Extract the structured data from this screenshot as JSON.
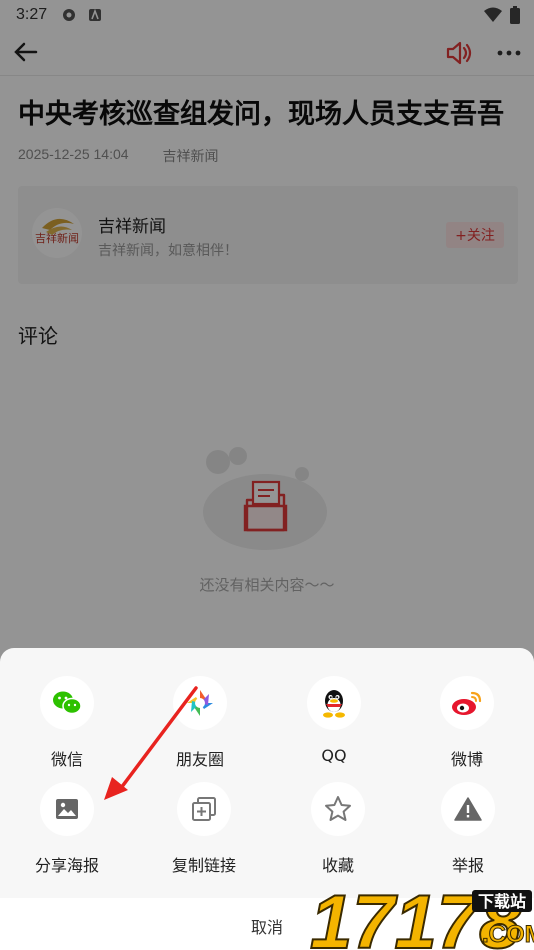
{
  "status_bar": {
    "time": "3:27"
  },
  "article": {
    "title": "中央考核巡查组发问，现场人员支支吾吾",
    "date": "2025-12-25 14:04",
    "source": "吉祥新闻"
  },
  "author": {
    "logo_text": "吉祥新闻",
    "name": "吉祥新闻",
    "description": "吉祥新闻，如意相伴！",
    "follow_label": "+关注"
  },
  "comments": {
    "heading": "评论",
    "empty_text": "还没有相关内容～～"
  },
  "share_sheet": {
    "row1": [
      {
        "label": "微信",
        "icon": "wechat-icon"
      },
      {
        "label": "朋友圈",
        "icon": "moments-icon"
      },
      {
        "label": "QQ",
        "icon": "qq-icon"
      },
      {
        "label": "微博",
        "icon": "weibo-icon"
      }
    ],
    "row2": [
      {
        "label": "分享海报",
        "icon": "image-icon"
      },
      {
        "label": "复制链接",
        "icon": "copy-icon"
      },
      {
        "label": "收藏",
        "icon": "star-icon"
      },
      {
        "label": "举报",
        "icon": "warning-icon"
      }
    ],
    "cancel_label": "取消"
  },
  "watermark": {
    "number": "17178",
    "tag": "下载站",
    "suffix": ".COM"
  },
  "colors": {
    "accent_red": "#e03a3a",
    "wechat_green": "#2dc100",
    "weibo_red": "#e6162d"
  }
}
